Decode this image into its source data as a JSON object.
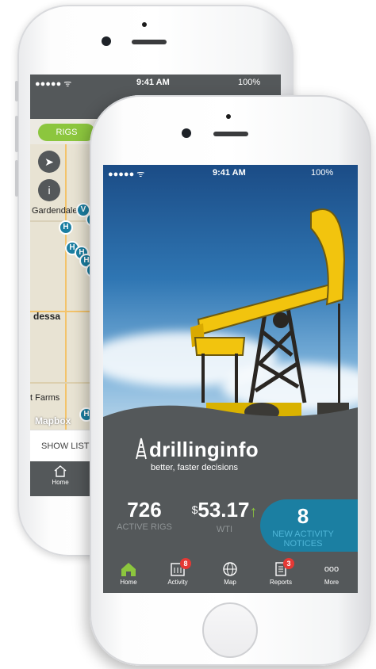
{
  "back_phone": {
    "status": {
      "carrier": "●●●●● ᯤ",
      "time": "9:41 AM",
      "battery": "100%"
    },
    "segment": {
      "rigs_label": "RIGS"
    },
    "map": {
      "labels": [
        "Gardendale",
        "Odessa",
        "West Odessa Farms"
      ],
      "visible_labels": [
        "Gardendale",
        "dessa",
        "t Farms"
      ],
      "pins": [
        "V",
        "V",
        "H",
        "H",
        "H",
        "H",
        "V",
        "H"
      ],
      "attribution": "Mapbox"
    },
    "show_list_label": "SHOW LIST",
    "tabbar": {
      "home_label": "Home"
    }
  },
  "front_phone": {
    "status": {
      "carrier": "●●●●● ᯤ",
      "time": "9:41 AM",
      "battery": "100%"
    },
    "brand": {
      "name": "drillinginfo",
      "tagline": "better, faster decisions"
    },
    "stats": {
      "rigs_value": "726",
      "rigs_label": "ACTIVE RIGS",
      "wti_prefix": "$",
      "wti_value": "53.17",
      "wti_trend": "↑",
      "wti_label": "WTI",
      "notices_value": "8",
      "notices_label_1": "NEW ACTIVITY",
      "notices_label_2": "NOTICES"
    },
    "tabbar": [
      {
        "label": "Home",
        "icon": "home-icon",
        "active": true
      },
      {
        "label": "Activity",
        "icon": "activity-icon",
        "badge": "8"
      },
      {
        "label": "Map",
        "icon": "globe-icon"
      },
      {
        "label": "Reports",
        "icon": "reports-icon",
        "badge": "3"
      },
      {
        "label": "More",
        "icon": "more-icon",
        "glyph": "ooo"
      }
    ]
  },
  "colors": {
    "accent_green": "#8cc63e",
    "accent_blue": "#1b7fa2",
    "bar_gray": "#54585a",
    "badge_red": "#e53935"
  }
}
